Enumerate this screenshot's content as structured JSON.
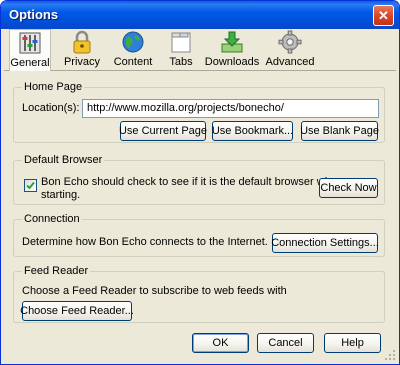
{
  "window": {
    "title": "Options",
    "close_symbol": "✕"
  },
  "toolbar": {
    "items": [
      {
        "label": "General",
        "icon": "general-icon",
        "selected": true
      },
      {
        "label": "Privacy",
        "icon": "lock-icon"
      },
      {
        "label": "Content",
        "icon": "globe-icon"
      },
      {
        "label": "Tabs",
        "icon": "tabs-icon"
      },
      {
        "label": "Downloads",
        "icon": "download-icon"
      },
      {
        "label": "Advanced",
        "icon": "gear-icon"
      }
    ]
  },
  "home_page": {
    "legend": "Home Page",
    "location_label": "Location(s):",
    "location_value": "http://www.mozilla.org/projects/bonecho/",
    "use_current": "Use Current Page",
    "use_bookmark": "Use Bookmark...",
    "use_blank": "Use Blank Page"
  },
  "default_browser": {
    "legend": "Default Browser",
    "check_text_1": "Bon Echo should check to see if it is the default browser when",
    "check_text_2": "starting.",
    "checked": true,
    "check_now": "Check Now"
  },
  "connection": {
    "legend": "Connection",
    "description": "Determine how Bon Echo connects to the Internet.",
    "settings_button": "Connection Settings..."
  },
  "feed_reader": {
    "legend": "Feed Reader",
    "description": "Choose a Feed Reader to subscribe to web feeds with",
    "choose_button": "Choose Feed Reader..."
  },
  "footer": {
    "ok": "OK",
    "cancel": "Cancel",
    "help": "Help"
  },
  "colors": {
    "titlebar": "#0058e8",
    "dialog_bg": "#ece9d8",
    "button_border": "#003c74"
  }
}
